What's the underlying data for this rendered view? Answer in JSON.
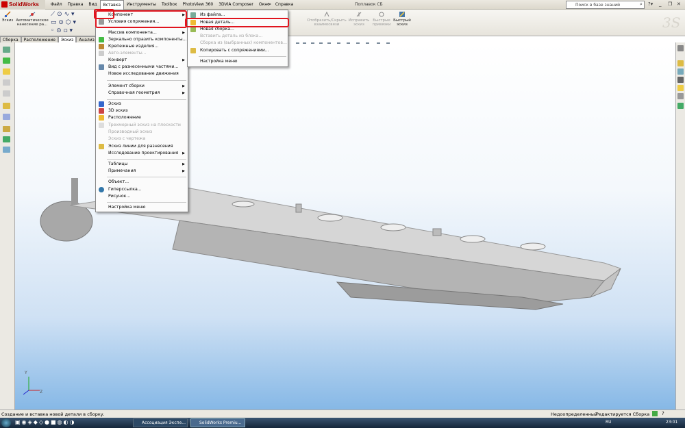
{
  "app": {
    "logo": "SolidWorks",
    "document_title": "Поплавок СБ"
  },
  "menu": [
    "Файл",
    "Правка",
    "Вид",
    "Вставка",
    "Инструменты",
    "Toolbox",
    "PhotoView 360",
    "3DVIA Composer",
    "Окно",
    "Справка"
  ],
  "search": {
    "placeholder": "Поиск в базе знаний"
  },
  "toolbar": {
    "sketch": "Эскиз",
    "auto_dim": "Автоматическое нанесение ра...",
    "show_hide": "Отобразить/Скрыть взаимосвязи",
    "repair": "Исправить эскиз",
    "quick_snaps": "Быстрые привязки",
    "rapid_sketch": "Быстрый эскиз"
  },
  "tabs": [
    "Сборка",
    "Расположение",
    "Эскиз",
    "Анализ"
  ],
  "insert_menu": {
    "items": [
      {
        "label": "Компонент",
        "submenu": true,
        "disabled": false
      },
      {
        "label": "Условия сопряжения...",
        "submenu": false,
        "disabled": false
      },
      {
        "label": "Массив компонента...",
        "submenu": true,
        "disabled": false
      },
      {
        "label": "Зеркально отразить компоненты...",
        "submenu": false,
        "disabled": false
      },
      {
        "label": "Крепежные изделия...",
        "submenu": false,
        "disabled": false
      },
      {
        "label": "Авто-элементы...",
        "submenu": false,
        "disabled": true
      },
      {
        "label": "Конверт",
        "submenu": true,
        "disabled": false
      },
      {
        "label": "Вид с разнесенными частями...",
        "submenu": false,
        "disabled": false
      },
      {
        "label": "Новое исследование движения",
        "submenu": false,
        "disabled": false
      },
      {
        "label": "Элемент сборки",
        "submenu": true,
        "disabled": false
      },
      {
        "label": "Справочная геометрия",
        "submenu": true,
        "disabled": false
      },
      {
        "label": "Эскиз",
        "submenu": false,
        "disabled": false
      },
      {
        "label": "3D эскиз",
        "submenu": false,
        "disabled": false
      },
      {
        "label": "Расположение",
        "submenu": false,
        "disabled": false
      },
      {
        "label": "Трехмерный эскиз на плоскости",
        "submenu": false,
        "disabled": true
      },
      {
        "label": "Производный эскиз",
        "submenu": false,
        "disabled": true
      },
      {
        "label": "Эскиз с чертежа",
        "submenu": false,
        "disabled": true
      },
      {
        "label": "Эскиз линии для разнесения",
        "submenu": false,
        "disabled": false
      },
      {
        "label": "Исследование проектирования",
        "submenu": true,
        "disabled": false
      },
      {
        "label": "Таблицы",
        "submenu": true,
        "disabled": false
      },
      {
        "label": "Примечания",
        "submenu": true,
        "disabled": false
      },
      {
        "label": "Объект...",
        "submenu": false,
        "disabled": false
      },
      {
        "label": "Гиперссылка...",
        "submenu": false,
        "disabled": false
      },
      {
        "label": "Рисунок...",
        "submenu": false,
        "disabled": false
      },
      {
        "label": "Настройка меню",
        "submenu": false,
        "disabled": false
      }
    ]
  },
  "component_submenu": {
    "items": [
      {
        "label": "Из файла...",
        "disabled": false
      },
      {
        "label": "Новая деталь...",
        "disabled": false
      },
      {
        "label": "Новая сборка...",
        "disabled": false
      },
      {
        "label": "Вставить деталь из блока...",
        "disabled": true
      },
      {
        "label": "Сборка из (выбранных) компонентов...",
        "disabled": true
      },
      {
        "label": "Копировать с сопряжениями...",
        "disabled": false
      },
      {
        "label": "Настройка меню",
        "disabled": false
      }
    ]
  },
  "status_bar": {
    "message": "Создание и вставка новой детали в сборку.",
    "state": "Недоопределенный",
    "mode": "Редактируется Сборка"
  },
  "taskbar": {
    "tasks": [
      "Ассоциация Экспе...",
      "SolidWorks Premiu..."
    ],
    "lang": "RU",
    "clock": "23:01"
  },
  "colors": {
    "highlight": "#e0141e",
    "viewport_top": "#ffffff",
    "viewport_bottom": "#86b8e6"
  }
}
